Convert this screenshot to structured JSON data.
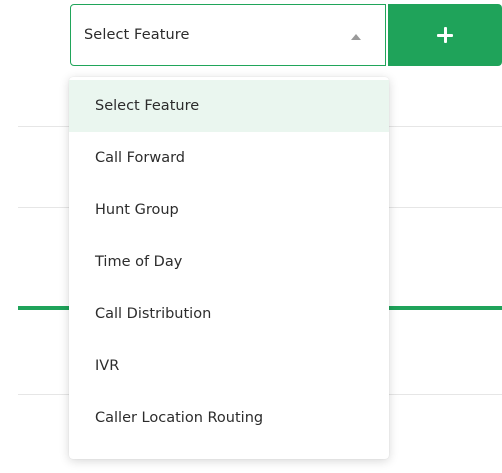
{
  "select": {
    "value": "Select Feature"
  },
  "add_button": {
    "icon": "plus-icon"
  },
  "dropdown": {
    "options": [
      "Select Feature",
      "Call Forward",
      "Hunt Group",
      "Time of Day",
      "Call Distribution",
      "IVR",
      "Caller Location Routing"
    ],
    "selected_index": 0
  },
  "colors": {
    "accent": "#1fa35a",
    "selected_bg": "#eaf6ef",
    "text": "#2c2c2c"
  }
}
